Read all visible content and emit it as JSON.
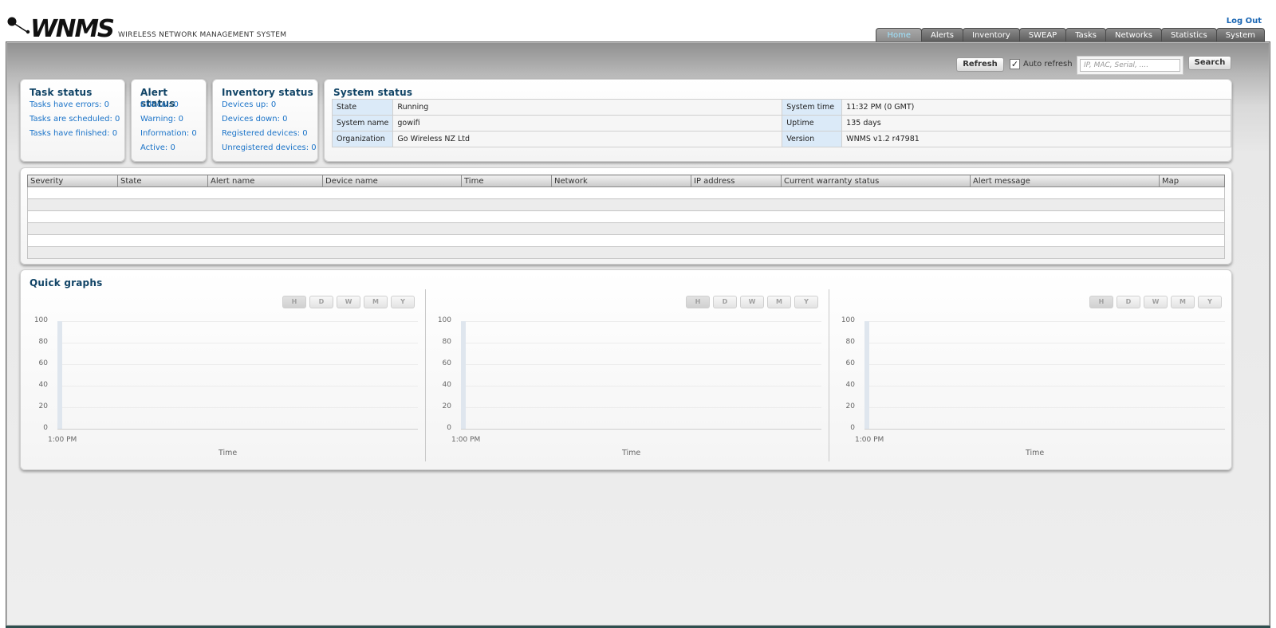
{
  "header": {
    "logo_text": "WNMS",
    "subtitle": "WIRELESS NETWORK MANAGEMENT SYSTEM",
    "logout": "Log Out",
    "tabs": [
      "Home",
      "Alerts",
      "Inventory",
      "SWEAP",
      "Tasks",
      "Networks",
      "Statistics",
      "System"
    ],
    "active_tab": "Home"
  },
  "toolbar": {
    "refresh_label": "Refresh",
    "auto_refresh_checked": true,
    "auto_refresh_label": "Auto refresh",
    "search_placeholder": "IP, MAC, Serial, ....",
    "search_label": "Search"
  },
  "task_status": {
    "title": "Task status",
    "items": [
      "Tasks have errors: 0",
      "Tasks are scheduled: 0",
      "Tasks have finished: 0"
    ]
  },
  "alert_status": {
    "title": "Alert status",
    "items": [
      "Critical: 0",
      "Warning: 0",
      "Information: 0",
      "Active: 0"
    ]
  },
  "inventory_status": {
    "title": "Inventory status",
    "items": [
      "Devices up: 0",
      "Devices down: 0",
      "Registered devices: 0",
      "Unregistered devices: 0"
    ]
  },
  "system_status": {
    "title": "System status",
    "rows": [
      {
        "k1": "State",
        "v1": "Running",
        "k2": "System time",
        "v2": "11:32 PM  (0 GMT)"
      },
      {
        "k1": "System name",
        "v1": "gowifi",
        "k2": "Uptime",
        "v2": "135 days"
      },
      {
        "k1": "Organization",
        "v1": "Go Wireless NZ Ltd",
        "k2": "Version",
        "v2": "WNMS v1.2 r47981"
      }
    ]
  },
  "alerts_table": {
    "columns": [
      "Severity",
      "State",
      "Alert name",
      "Device name",
      "Time",
      "Network",
      "IP address",
      "Current warranty status",
      "Alert message",
      "Map"
    ]
  },
  "quick_graphs": {
    "title": "Quick graphs",
    "range_buttons": [
      "H",
      "D",
      "W",
      "M",
      "Y"
    ],
    "y_ticks": [
      "100",
      "80",
      "60",
      "40",
      "20",
      "0"
    ],
    "x_tick": "1:00 PM",
    "x_label": "Time"
  },
  "colors": {
    "link": "#1a73c8",
    "title": "#114466",
    "active_tab_text": "#9fe4ff"
  }
}
